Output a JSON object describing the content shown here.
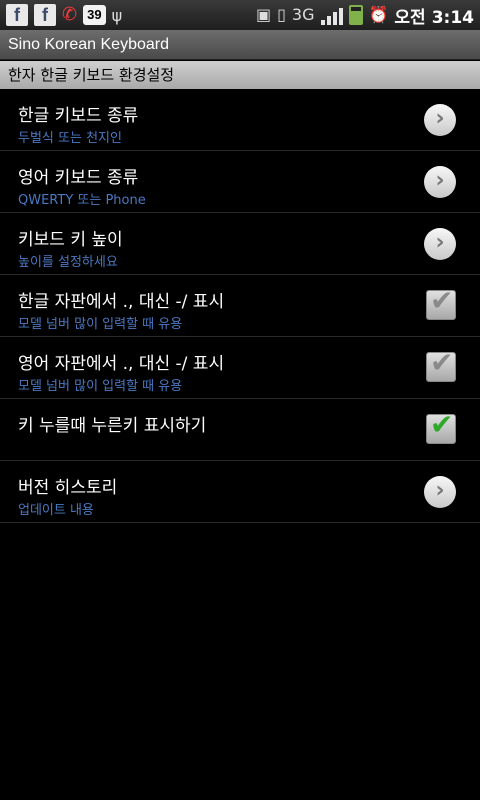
{
  "statusbar": {
    "notifications": [
      "f",
      "f"
    ],
    "missed_call_count": "39",
    "network": "3G",
    "time_ampm": "오전",
    "time": "3:14"
  },
  "app": {
    "title": "Sino Korean Keyboard"
  },
  "section": {
    "header": "한자 한글 키보드 환경설정"
  },
  "settings": [
    {
      "title": "한글 키보드 종류",
      "subtitle": "두벌식 또는 천지인",
      "control": "chevron"
    },
    {
      "title": "영어 키보드 종류",
      "subtitle": "QWERTY 또는 Phone",
      "control": "chevron"
    },
    {
      "title": "키보드 키 높이",
      "subtitle": "높이를 설정하세요",
      "control": "chevron"
    },
    {
      "title": "한글 자판에서 ., 대신 -/ 표시",
      "subtitle": "모델 넘버 많이 입력할 때 유용",
      "control": "checkbox",
      "checked": false
    },
    {
      "title": "영어 자판에서 ., 대신 -/ 표시",
      "subtitle": "모델 넘버 많이 입력할 때 유용",
      "control": "checkbox",
      "checked": false
    },
    {
      "title": "키 누를때 누른키 표시하기",
      "subtitle": "",
      "control": "checkbox",
      "checked": true
    },
    {
      "title": "버전 히스토리",
      "subtitle": "업데이트 내용",
      "control": "chevron"
    }
  ],
  "colors": {
    "subtitle": "#4b78c2",
    "check_on": "#2fa82b",
    "check_off": "#8a8a8a"
  }
}
